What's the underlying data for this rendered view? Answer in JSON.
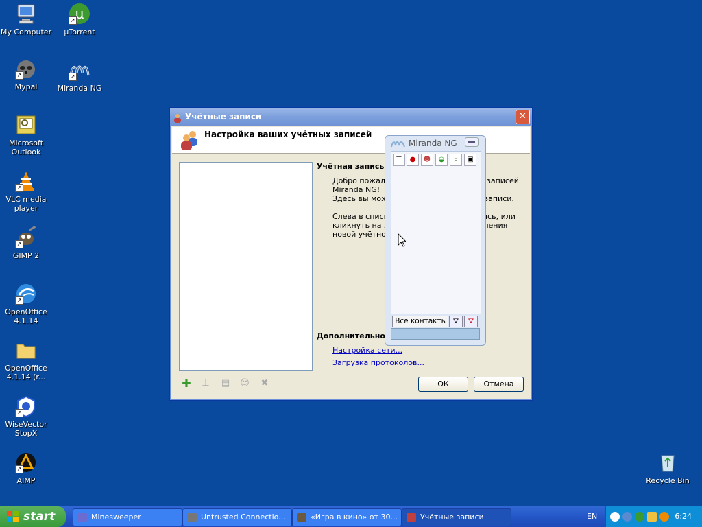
{
  "desktop": {
    "icons": [
      {
        "label": "My Computer",
        "icon": "my-computer-icon"
      },
      {
        "label": "µTorrent",
        "icon": "utorrent-icon"
      },
      {
        "label": "Mypal",
        "icon": "mypal-icon"
      },
      {
        "label": "Miranda NG",
        "icon": "miranda-icon"
      },
      {
        "label": "Microsoft Outlook",
        "icon": "outlook-icon"
      },
      {
        "label": "VLC media player",
        "icon": "vlc-icon"
      },
      {
        "label": "GIMP 2",
        "icon": "gimp-icon"
      },
      {
        "label": "OpenOffice 4.1.14",
        "icon": "openoffice-icon"
      },
      {
        "label": "OpenOffice 4.1.14 (r...",
        "icon": "folder-icon"
      },
      {
        "label": "WiseVector StopX",
        "icon": "wisevector-icon"
      },
      {
        "label": "AIMP",
        "icon": "aimp-icon"
      },
      {
        "label": "Recycle Bin",
        "icon": "recycle-bin-icon"
      }
    ]
  },
  "dialog": {
    "title": "Учётные записи",
    "header": "Настройка ваших учётных записей",
    "account_label": "Учётная запись:",
    "welcome_lines": [
      "Добро пожалова",
      "Miranda NG!",
      "Здесь вы можете"
    ],
    "welcome_right": [
      "записей",
      "е записи."
    ],
    "left_lines": [
      "Слева в списке м",
      "кликнуть на знач",
      "новой учётной за"
    ],
    "left_right": [
      "апись, или",
      "вления"
    ],
    "additional_label": "Дополнительно:",
    "links": [
      "Настройка сети...",
      "Загрузка протоколов..."
    ],
    "ok": "ОК",
    "cancel": "Отмена"
  },
  "miranda": {
    "title": "Miranda NG",
    "filter_label": "Все контакть"
  },
  "taskbar": {
    "start_label": "start",
    "tasks": [
      {
        "label": "Minesweeper"
      },
      {
        "label": "Untrusted Connectio..."
      },
      {
        "label": "«Игра в кино» от 30..."
      },
      {
        "label": "Учётные записи"
      }
    ],
    "lang": "EN",
    "clock": "6:24"
  },
  "colors": {
    "desktop": "#0a4a9e",
    "taskbar": "#2456c7",
    "start": "#3a9a3a"
  }
}
